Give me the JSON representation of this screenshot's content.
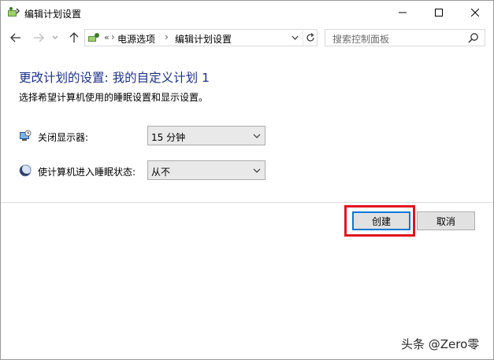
{
  "window": {
    "title": "编辑计划设置"
  },
  "nav": {
    "back_icon": "arrow-left-icon",
    "forward_icon": "arrow-right-icon",
    "up_icon": "arrow-up-icon",
    "address_overflow": "«",
    "breadcrumbs": [
      "电源选项",
      "编辑计划设置"
    ],
    "search_placeholder": "搜索控制面板"
  },
  "content": {
    "heading": "更改计划的设置: 我的自定义计划 1",
    "subtitle": "选择希望计算机使用的睡眠设置和显示设置。",
    "settings": [
      {
        "icon": "monitor-clock-icon",
        "label": "关闭显示器:",
        "value": "15 分钟"
      },
      {
        "icon": "moon-icon",
        "label": "使计算机进入睡眠状态:",
        "value": "从不"
      }
    ]
  },
  "buttons": {
    "create": "创建",
    "cancel": "取消"
  },
  "watermark": "头条 @Zero零",
  "colors": {
    "heading": "#1e3287",
    "highlight": "#e0141e",
    "focus_border": "#0078d7"
  }
}
